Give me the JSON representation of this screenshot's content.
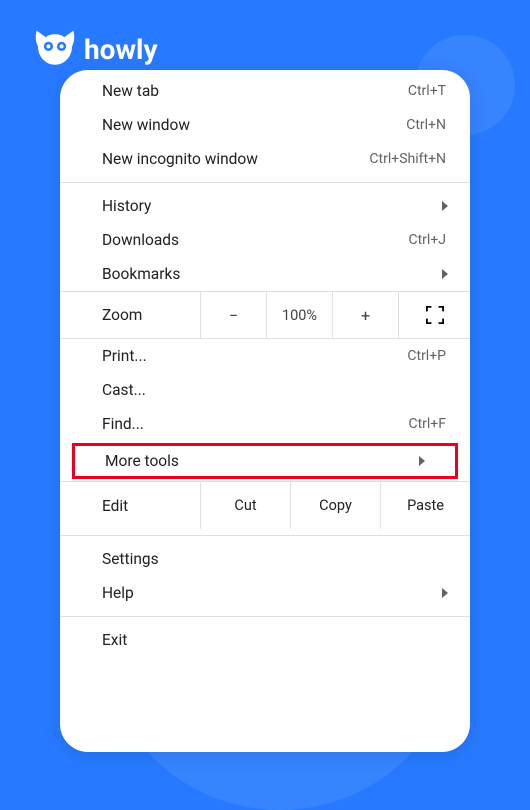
{
  "brand": "howly",
  "menu": {
    "new_tab": {
      "label": "New tab",
      "shortcut": "Ctrl+T"
    },
    "new_window": {
      "label": "New window",
      "shortcut": "Ctrl+N"
    },
    "new_incognito": {
      "label": "New incognito window",
      "shortcut": "Ctrl+Shift+N"
    },
    "history": {
      "label": "History"
    },
    "downloads": {
      "label": "Downloads",
      "shortcut": "Ctrl+J"
    },
    "bookmarks": {
      "label": "Bookmarks"
    },
    "zoom": {
      "label": "Zoom",
      "minus": "−",
      "value": "100%",
      "plus": "+"
    },
    "print": {
      "label": "Print...",
      "shortcut": "Ctrl+P"
    },
    "cast": {
      "label": "Cast..."
    },
    "find": {
      "label": "Find...",
      "shortcut": "Ctrl+F"
    },
    "more_tools": {
      "label": "More tools"
    },
    "edit": {
      "label": "Edit",
      "cut": "Cut",
      "copy": "Copy",
      "paste": "Paste"
    },
    "settings": {
      "label": "Settings"
    },
    "help": {
      "label": "Help"
    },
    "exit": {
      "label": "Exit"
    }
  }
}
